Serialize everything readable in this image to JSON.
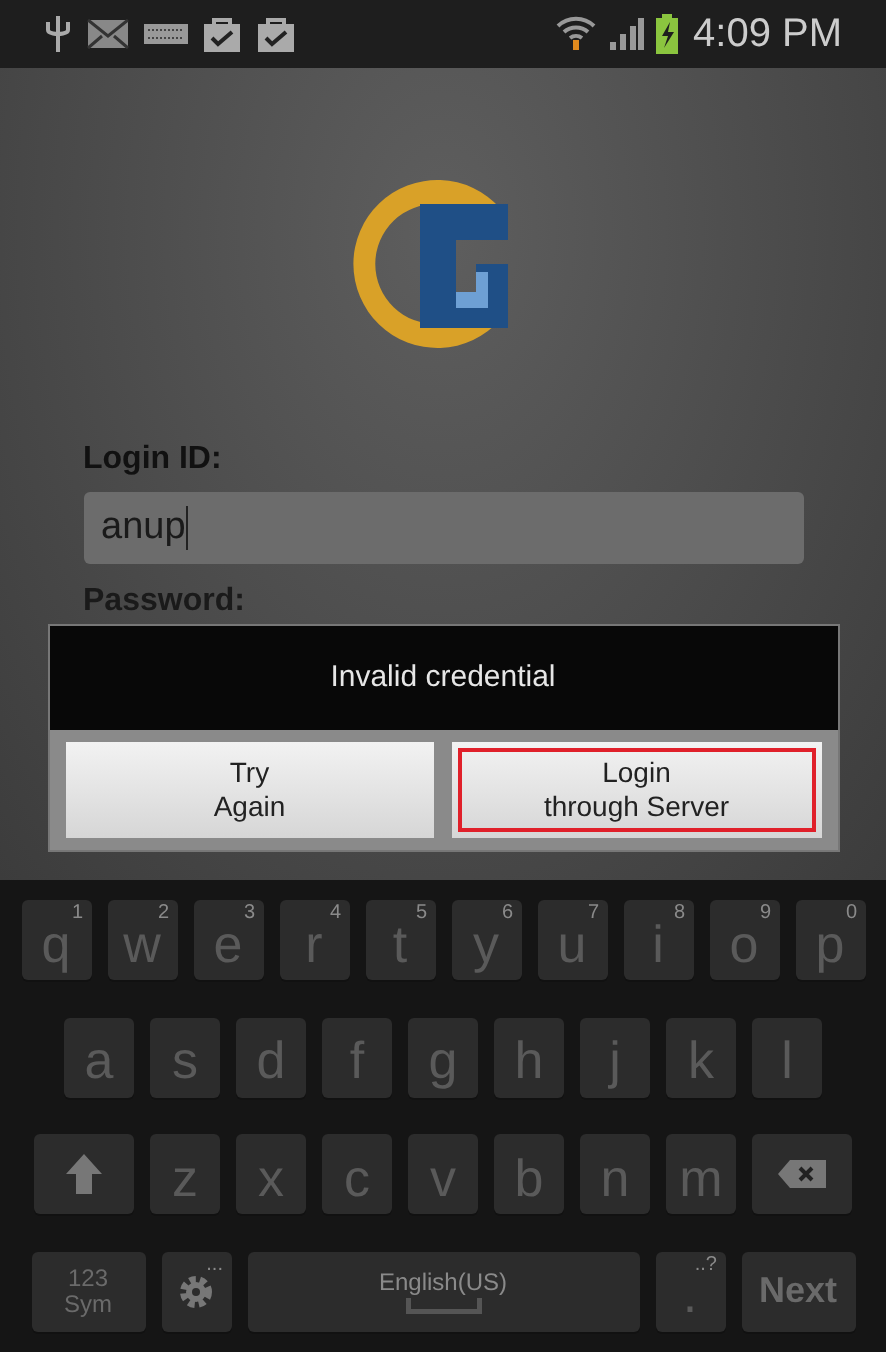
{
  "status_bar": {
    "time": "4:09 PM",
    "battery_charging": true
  },
  "login": {
    "id_label": "Login ID:",
    "id_value": "anup",
    "password_label": "Password:"
  },
  "dialog": {
    "message": "Invalid credential",
    "buttons": [
      {
        "label": "Try\nAgain",
        "highlighted": false
      },
      {
        "label": "Login\nthrough Server",
        "highlighted": true
      }
    ]
  },
  "keyboard": {
    "rows": [
      {
        "keys": [
          {
            "kind": "letter",
            "label": "q",
            "hint": "1"
          },
          {
            "kind": "letter",
            "label": "w",
            "hint": "2"
          },
          {
            "kind": "letter",
            "label": "e",
            "hint": "3"
          },
          {
            "kind": "letter",
            "label": "r",
            "hint": "4"
          },
          {
            "kind": "letter",
            "label": "t",
            "hint": "5"
          },
          {
            "kind": "letter",
            "label": "y",
            "hint": "6"
          },
          {
            "kind": "letter",
            "label": "u",
            "hint": "7"
          },
          {
            "kind": "letter",
            "label": "i",
            "hint": "8"
          },
          {
            "kind": "letter",
            "label": "o",
            "hint": "9"
          },
          {
            "kind": "letter",
            "label": "p",
            "hint": "0"
          }
        ]
      },
      {
        "keys": [
          {
            "kind": "letter",
            "label": "a"
          },
          {
            "kind": "letter",
            "label": "s"
          },
          {
            "kind": "letter",
            "label": "d"
          },
          {
            "kind": "letter",
            "label": "f"
          },
          {
            "kind": "letter",
            "label": "g"
          },
          {
            "kind": "letter",
            "label": "h"
          },
          {
            "kind": "letter",
            "label": "j"
          },
          {
            "kind": "letter",
            "label": "k"
          },
          {
            "kind": "letter",
            "label": "l"
          }
        ]
      },
      {
        "keys": [
          {
            "kind": "shift"
          },
          {
            "kind": "letter",
            "label": "z"
          },
          {
            "kind": "letter",
            "label": "x"
          },
          {
            "kind": "letter",
            "label": "c"
          },
          {
            "kind": "letter",
            "label": "v"
          },
          {
            "kind": "letter",
            "label": "b"
          },
          {
            "kind": "letter",
            "label": "n"
          },
          {
            "kind": "letter",
            "label": "m"
          },
          {
            "kind": "backspace"
          }
        ]
      },
      {
        "keys": [
          {
            "kind": "sym",
            "label": "123\nSym"
          },
          {
            "kind": "settings",
            "hint": "..."
          },
          {
            "kind": "space",
            "label": "English(US)"
          },
          {
            "kind": "letter",
            "label": ".",
            "hint": "..?"
          },
          {
            "kind": "action",
            "label": "Next"
          }
        ]
      }
    ]
  }
}
